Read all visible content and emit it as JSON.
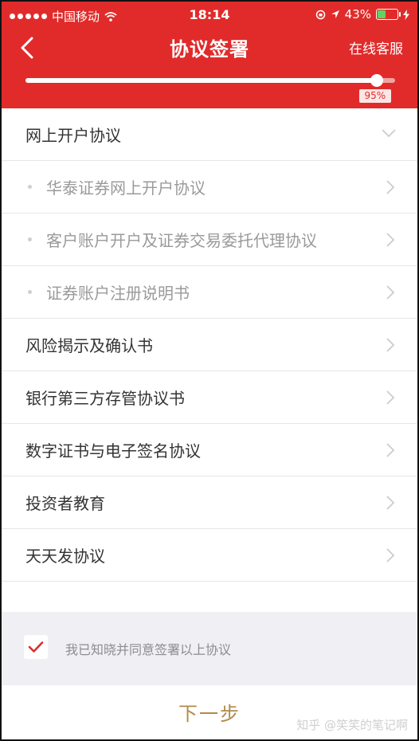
{
  "status_bar": {
    "carrier": "中国移动",
    "time": "18:14",
    "battery": "43%"
  },
  "nav": {
    "title": "协议签署",
    "service_label": "在线客服",
    "back_icon": "chevron-left-icon"
  },
  "progress": {
    "percent": 95,
    "label": "95%"
  },
  "list": {
    "items": [
      {
        "label": "网上开户协议",
        "type": "group",
        "expanded": true
      },
      {
        "label": "华泰证券网上开户协议",
        "type": "sub"
      },
      {
        "label": "客户账户开户及证券交易委托代理协议",
        "type": "sub"
      },
      {
        "label": "证券账户注册说明书",
        "type": "sub"
      },
      {
        "label": "风险揭示及确认书",
        "type": "item"
      },
      {
        "label": "银行第三方存管协议书",
        "type": "item"
      },
      {
        "label": "数字证书与电子签名协议",
        "type": "item"
      },
      {
        "label": "投资者教育",
        "type": "item"
      },
      {
        "label": "天天发协议",
        "type": "item"
      }
    ]
  },
  "agreement": {
    "checked": true,
    "text": "我已知晓并同意签署以上协议"
  },
  "next_label": "下一步",
  "watermark": "知乎 @笑笑的笔记啊",
  "colors": {
    "brand_red": "#e12b2b",
    "gold": "#b18a4a",
    "gray_text": "#9a9a9a"
  }
}
